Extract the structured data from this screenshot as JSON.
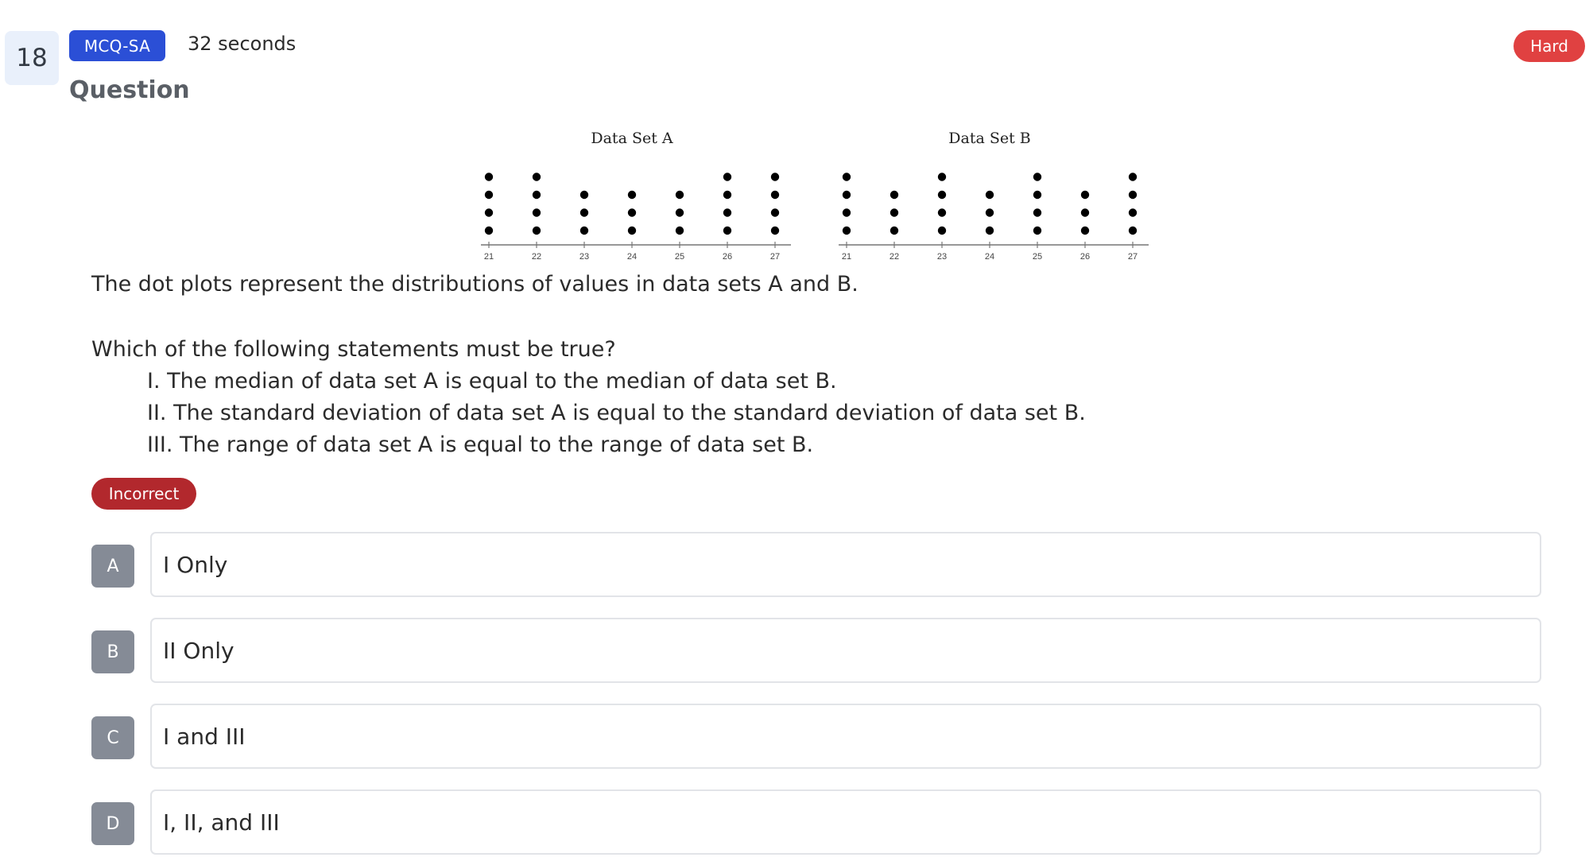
{
  "header": {
    "question_number": "18",
    "type_badge": "MCQ-SA",
    "time": "32 seconds",
    "difficulty": "Hard",
    "difficulty_color": "#e04141",
    "type_color": "#2b4fd6"
  },
  "section_title": "Question",
  "chart_data": [
    {
      "type": "scatter",
      "title": "Data Set A",
      "xlabel": "",
      "ylabel": "",
      "x_ticks": [
        21,
        22,
        23,
        24,
        25,
        26,
        27
      ],
      "dot_counts": [
        4,
        4,
        3,
        3,
        3,
        4,
        4
      ]
    },
    {
      "type": "scatter",
      "title": "Data Set B",
      "xlabel": "",
      "ylabel": "",
      "x_ticks": [
        21,
        22,
        23,
        24,
        25,
        26,
        27
      ],
      "dot_counts": [
        4,
        3,
        4,
        3,
        4,
        3,
        4
      ]
    }
  ],
  "stem": {
    "intro": "The dot plots represent the distributions of values in data sets A and B.",
    "prompt": "Which of the following statements must be true?",
    "statements": [
      "I. The median of data set A is equal to the median of data set B.",
      "II. The standard deviation of data set A is equal to the standard deviation of data set B.",
      "III. The range of data set A is equal to the range of data set B."
    ]
  },
  "result": {
    "label": "Incorrect",
    "color": "#b2282d"
  },
  "choices": [
    {
      "letter": "A",
      "text": "I Only"
    },
    {
      "letter": "B",
      "text": "II Only"
    },
    {
      "letter": "C",
      "text": "I and III"
    },
    {
      "letter": "D",
      "text": "I, II, and III"
    }
  ]
}
